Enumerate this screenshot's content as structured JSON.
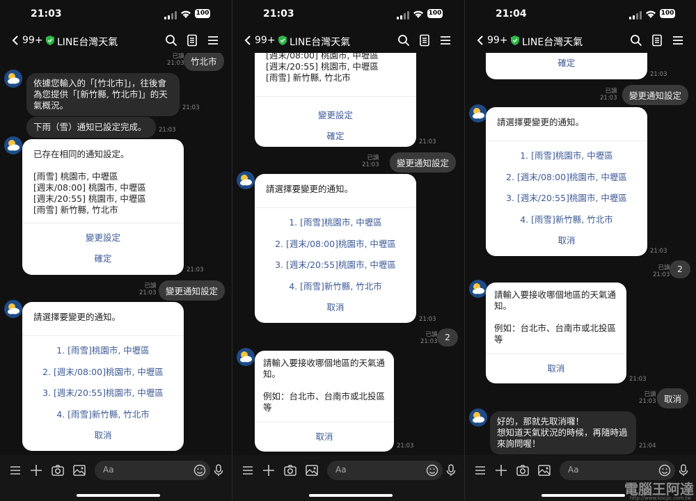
{
  "panels": [
    {
      "time": "21:03"
    },
    {
      "time": "21:03"
    },
    {
      "time": "21:04"
    }
  ],
  "header": {
    "back_count": "99+",
    "title": "LINE台灣天氣"
  },
  "input": {
    "placeholder": "Aa"
  },
  "labels": {
    "read": "已讀"
  },
  "colors": {
    "card_link": "#3d5a96",
    "verified_shield": "#2fb84a",
    "avatar_bg": "#1e4b87"
  },
  "p0": {
    "sent_city": "竹北市",
    "sent_city_time": "21:03",
    "msg1": "依據您輸入的「[竹北市]」，往後會\n為您提供「[新竹縣, 竹北市]」的天\n氣概況。",
    "msg1_time": "21:03",
    "msg2": "下雨（雪）通知已設定完成。",
    "msg2_time": "21:03",
    "card1_body": "已存在相同的通知設定。\n\n[雨雪] 桃園市, 中壢區\n[週末/08:00] 桃園市, 中壢區\n[週末/20:55] 桃園市, 中壢區\n[雨雪] 新竹縣, 竹北市",
    "card1_change": "變更設定",
    "card1_confirm": "確定",
    "card1_time": "21:03",
    "sent_change": "變更通知設定",
    "sent_change_time": "21:03",
    "card2_title": "請選擇要變更的通知。",
    "options": [
      "1. [雨雪]桃園市, 中壢區",
      "2. [週末/08:00]桃園市, 中壢區",
      "3. [週末/20:55]桃園市, 中壢區",
      "4. [雨雪]新竹縣, 竹北市"
    ],
    "cancel": "取消"
  },
  "p1": {
    "card1_lines": "[週末/08:00] 桃園市, 中壢區\n[週末/20:55] 桃園市, 中壢區\n[雨雪] 新竹縣, 竹北市",
    "card1_change": "變更設定",
    "card1_confirm": "確定",
    "card1_time": "21:03",
    "sent_change": "變更通知設定",
    "sent_change_time": "21:03",
    "card2_title": "請選擇要變更的通知。",
    "options": [
      "1. [雨雪]桃園市, 中壢區",
      "2. [週末/08:00]桃園市, 中壢區",
      "3. [週末/20:55]桃園市, 中壢區",
      "4. [雨雪]新竹縣, 竹北市"
    ],
    "cancel": "取消",
    "card2_time": "21:03",
    "sent_num": "2",
    "sent_num_time": "21:03",
    "card3_body": "請輸入要接收哪個地區的天氣通\n知。\n\n例如：台北市、台南市或北投區\n等",
    "card3_cancel": "取消",
    "card3_time": "21:03"
  },
  "p2": {
    "card1_confirm": "確定",
    "card1_time": "21:03",
    "sent_change": "變更通知設定",
    "sent_change_time": "21:03",
    "card2_title": "請選擇要變更的通知。",
    "options": [
      "1. [雨雪]桃園市, 中壢區",
      "2. [週末/08:00]桃園市, 中壢區",
      "3. [週末/20:55]桃園市, 中壢區",
      "4. [雨雪]新竹縣, 竹北市"
    ],
    "cancel": "取消",
    "card2_time": "21:03",
    "sent_num": "2",
    "sent_num_time": "21:03",
    "card3_body": "請輸入要接收哪個地區的天氣通\n知。\n\n例如：台北市、台南市或北投區\n等",
    "card3_cancel": "取消",
    "card3_time": "21:03",
    "sent_cancel": "取消",
    "sent_cancel_time": "21:03",
    "msg_end": "好的，那就先取消囉！\n想知道天氣狀況的時候，再隨時過\n來詢問喔！",
    "msg_end_time": "21:04"
  },
  "watermark": {
    "text": "電腦王阿達",
    "url": "http://www.kocpc.com.tw"
  }
}
